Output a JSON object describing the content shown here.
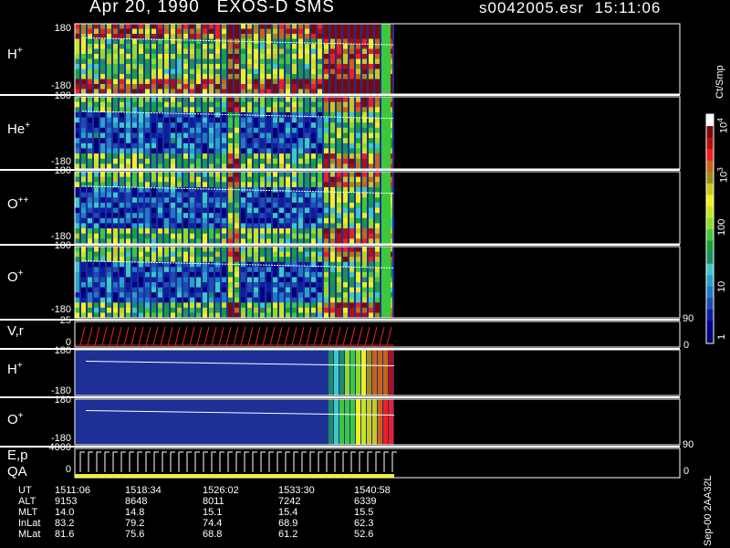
{
  "header": {
    "date_instrument": "Apr 20, 1990   EXOS-D SMS",
    "file_time": "s0042005.esr  15:11:06"
  },
  "chart_data": {
    "type": "heatmap",
    "panels": [
      {
        "id": "h_plus_pitch",
        "label": "H",
        "sup": "+",
        "ytop": "180",
        "ybot": "-180",
        "ylim": [
          -180,
          180
        ]
      },
      {
        "id": "he_plus_pitch",
        "label": "He",
        "sup": "+",
        "ytop": "180",
        "ybot": "-180",
        "ylim": [
          -180,
          180
        ]
      },
      {
        "id": "o_pp_pitch",
        "label": "O",
        "sup": "++",
        "ytop": "180",
        "ybot": "-180",
        "ylim": [
          -180,
          180
        ]
      },
      {
        "id": "o_plus_pitch",
        "label": "O",
        "sup": "+",
        "ytop": "180",
        "ybot": "-180",
        "ylim": [
          -180,
          180
        ]
      },
      {
        "id": "vr",
        "label": "V,r",
        "sup": "",
        "ytop": "25",
        "ybot": "0",
        "right_top": "90",
        "right_bot": "0"
      },
      {
        "id": "h_plus_b",
        "label": "H",
        "sup": "+",
        "ytop": "180",
        "ybot": "-180",
        "ylim": [
          -180,
          180
        ]
      },
      {
        "id": "o_plus_b",
        "label": "O",
        "sup": "+",
        "ytop": "180",
        "ybot": "-180",
        "ylim": [
          -180,
          180
        ]
      },
      {
        "id": "ep_qa",
        "label": "E,p",
        "label2": "QA",
        "sup": "",
        "ytop": "4000",
        "ybot": "0",
        "right_top": "90",
        "right_bot": "0"
      }
    ],
    "colorbar": {
      "unit": "Ct/Smp",
      "ticks": [
        "1",
        "10",
        "100",
        "10",
        "10"
      ],
      "exponents": [
        "",
        "",
        "",
        "3",
        "4"
      ],
      "colors": [
        "#000070",
        "#00008c",
        "#0a1fa0",
        "#1f4bb4",
        "#1f78c8",
        "#28a0c8",
        "#3cc8c8",
        "#1e8c64",
        "#14a03c",
        "#3cc83c",
        "#8cdc28",
        "#c8e61e",
        "#f0f01e",
        "#c8c81e",
        "#a08c14",
        "#c86414",
        "#f01e1e",
        "#b40f0f",
        "#780a0a",
        "#ffffff"
      ]
    },
    "x_axis": {
      "labels": [
        "UT",
        "ALT",
        "MLT",
        "InLat",
        "MLat"
      ],
      "columns": [
        {
          "UT": "1511:06",
          "ALT": "9153",
          "MLT": "14.0",
          "InLat": "83.2",
          "MLat": "81.6"
        },
        {
          "UT": "1518:34",
          "ALT": "8648",
          "MLT": "14.8",
          "InLat": "79.2",
          "MLat": "75.6"
        },
        {
          "UT": "1526:02",
          "ALT": "8011",
          "MLT": "15.1",
          "InLat": "74.4",
          "MLat": "68.8"
        },
        {
          "UT": "1533:30",
          "ALT": "7242",
          "MLT": "15.4",
          "InLat": "68.9",
          "MLat": "61.2"
        },
        {
          "UT": "1540:58",
          "ALT": "6339",
          "MLT": "15.5",
          "InLat": "62.3",
          "MLat": "52.6"
        }
      ]
    },
    "version_tag": "Sep-00  2AA32L"
  }
}
